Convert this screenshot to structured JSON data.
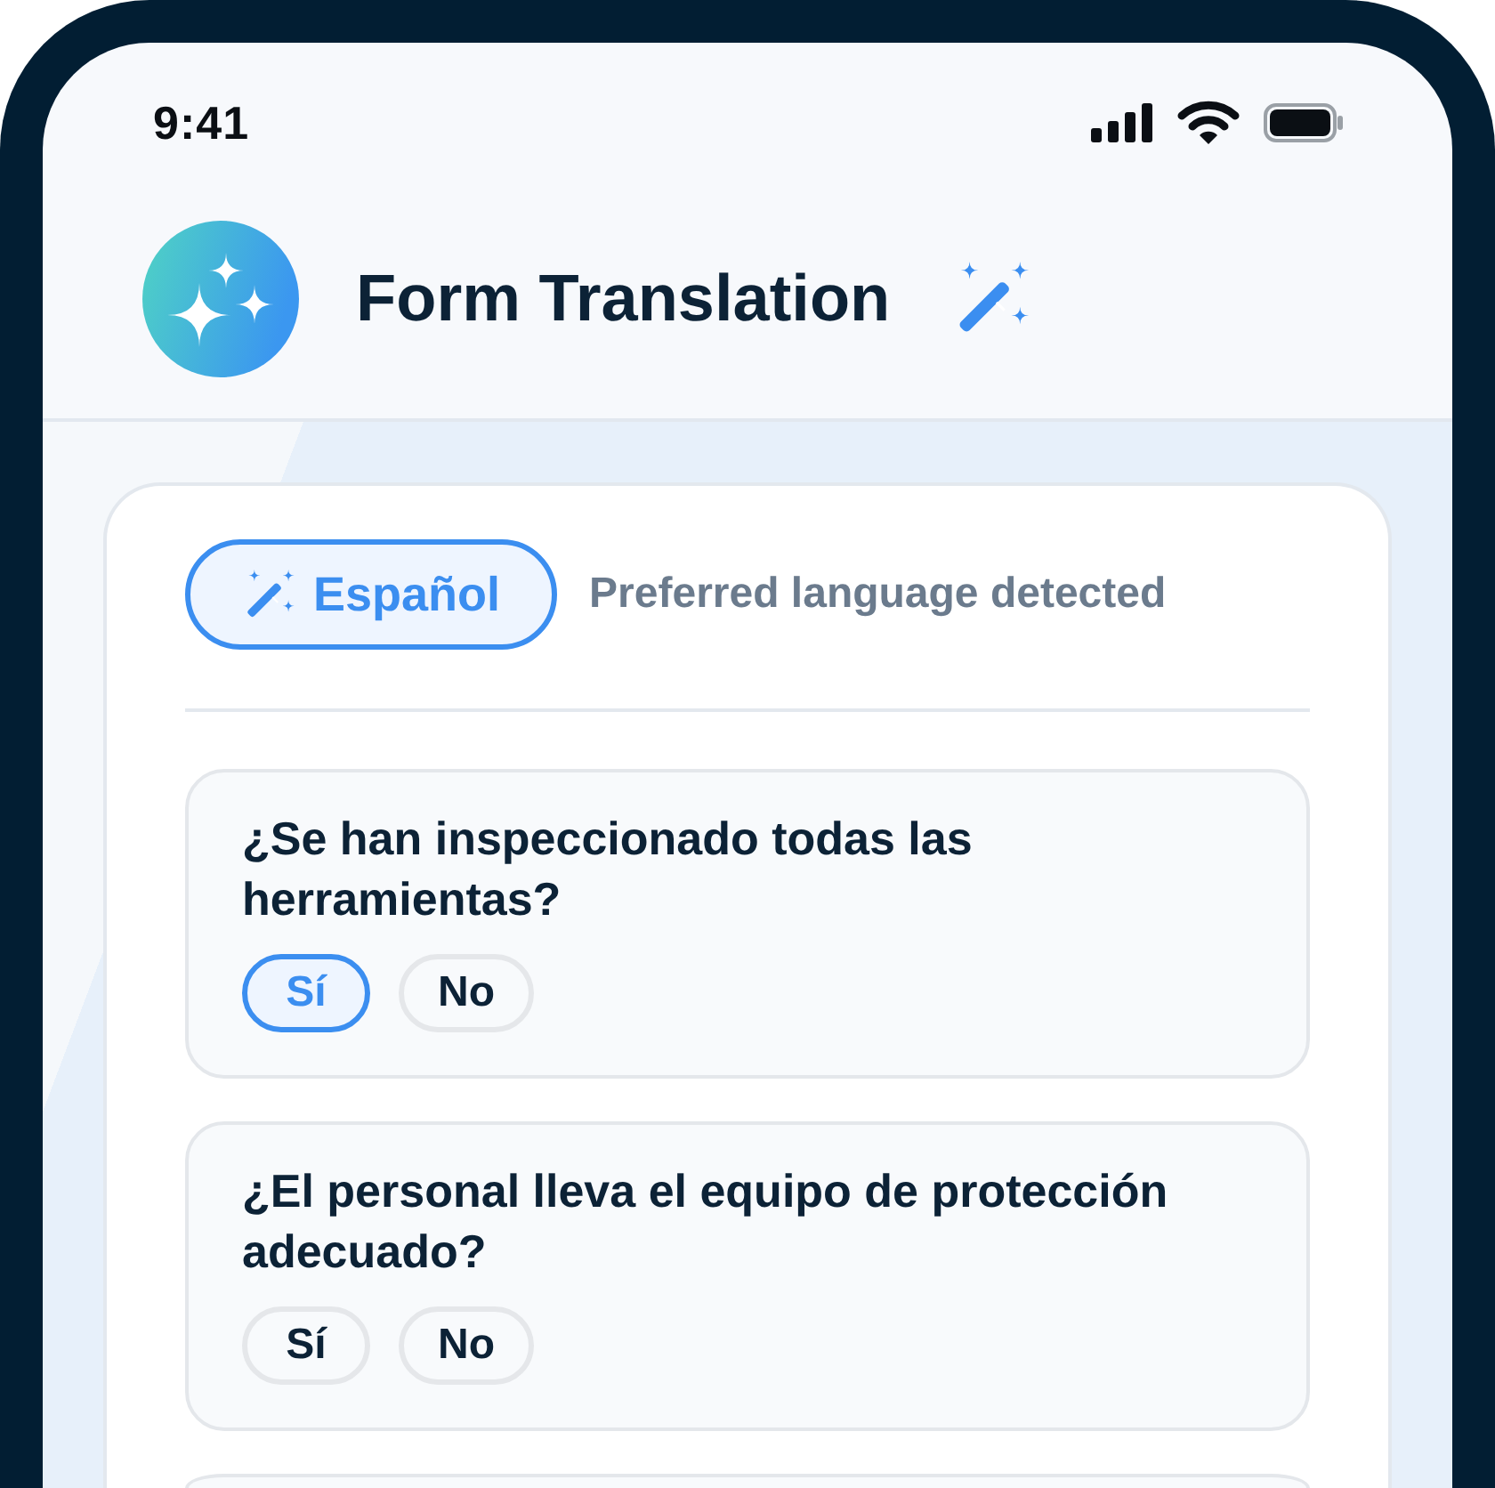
{
  "status_bar": {
    "time": "9:41"
  },
  "header": {
    "title": "Form Translation"
  },
  "language": {
    "label": "Español",
    "selected": true,
    "note": "Preferred language detected"
  },
  "questions": [
    {
      "text": "¿Se han inspeccionado todas las herramientas?",
      "options": [
        {
          "label": "Sí",
          "selected": true
        },
        {
          "label": "No",
          "selected": false
        }
      ]
    },
    {
      "text": "¿El personal lleva el equipo de protección adecuado?",
      "options": [
        {
          "label": "Sí",
          "selected": false
        },
        {
          "label": "No",
          "selected": false
        }
      ]
    }
  ],
  "more_below": true
}
